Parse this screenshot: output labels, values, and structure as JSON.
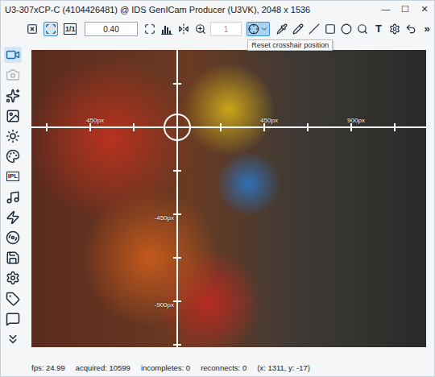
{
  "window": {
    "title": "U3-307xCP-C (4104426481) @ IDS GenICam Producer (U3VK), 2048 x 1536",
    "controls": [
      "—",
      "☐",
      "✕"
    ]
  },
  "toolbar": [
    {
      "kind": "button",
      "selected": false
    },
    {
      "kind": "button",
      "selected": true
    },
    {
      "kind": "text-button",
      "label": "1/1",
      "selected": false
    },
    {
      "kind": "field",
      "value": "0.40",
      "disabled": false
    },
    {
      "kind": "button",
      "selected": false
    },
    {
      "kind": "button",
      "selected": false
    },
    {
      "kind": "button",
      "selected": false
    },
    {
      "kind": "button",
      "selected": false
    },
    {
      "kind": "field",
      "value": "1",
      "disabled": true
    },
    {
      "kind": "menu-button",
      "selected": true
    },
    {
      "kind": "button",
      "selected": false
    },
    {
      "kind": "button",
      "selected": false
    },
    {
      "kind": "button",
      "selected": false
    },
    {
      "kind": "button",
      "selected": false
    },
    {
      "kind": "button",
      "selected": false
    },
    {
      "kind": "button",
      "selected": false
    },
    {
      "kind": "text-button",
      "label": "T",
      "selected": false
    },
    {
      "kind": "button",
      "selected": false
    },
    {
      "kind": "button",
      "selected": false
    },
    {
      "kind": "text-button",
      "label": "»",
      "selected": false
    }
  ],
  "tooltip": {
    "text": "Reset crosshair position"
  },
  "sidebar": [
    {
      "selected": true,
      "disabled": false
    },
    {
      "selected": false,
      "disabled": true
    },
    {
      "selected": false,
      "disabled": false
    },
    {
      "selected": false,
      "disabled": false
    },
    {
      "selected": false,
      "disabled": false
    },
    {
      "selected": false,
      "disabled": false
    },
    {
      "selected": false,
      "disabled": false,
      "label": "IPL"
    },
    {
      "selected": false,
      "disabled": false
    },
    {
      "selected": false,
      "disabled": false
    },
    {
      "selected": false,
      "disabled": false
    },
    {
      "selected": false,
      "disabled": false
    },
    {
      "selected": false,
      "disabled": false
    },
    {
      "selected": false,
      "disabled": false
    },
    {
      "selected": false,
      "disabled": false
    },
    {
      "selected": false,
      "disabled": false
    }
  ],
  "viewer": {
    "crosshair": {
      "x_labels": [
        "450px",
        "450px",
        "900px"
      ],
      "y_labels": [
        "-450px",
        "-900px"
      ]
    }
  },
  "status_bar": [
    "fps: 24.99",
    "acquired: 10599",
    "incompletes: 0",
    "reconnects: 0",
    "(x: 1311, y: -17)"
  ]
}
